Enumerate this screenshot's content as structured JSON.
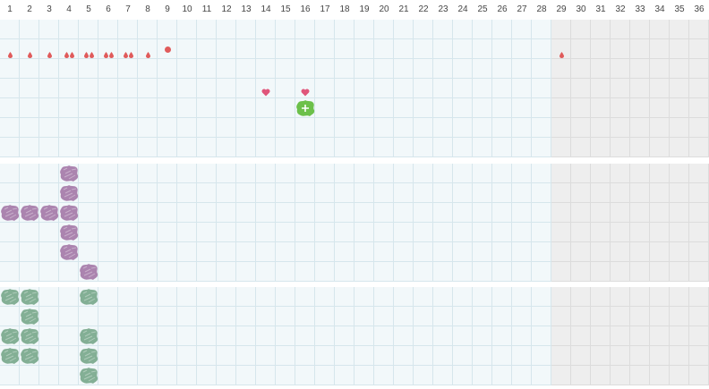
{
  "calendar": {
    "days": [
      "1",
      "2",
      "3",
      "4",
      "5",
      "6",
      "7",
      "8",
      "9",
      "10",
      "11",
      "12",
      "13",
      "14",
      "15",
      "16",
      "17",
      "18",
      "19",
      "20",
      "21",
      "22",
      "23",
      "24",
      "25",
      "26",
      "27",
      "28",
      "29",
      "30",
      "31",
      "32",
      "33",
      "34",
      "35",
      "36"
    ],
    "current_day": 28
  },
  "colors": {
    "period": "#e05b5b",
    "heart": "#e0557a",
    "ovulation": "#6cc04a",
    "symptom": "#a57aa8",
    "mood": "#7aa88c",
    "grid_line": "#d6e6ec",
    "cell_bg": "#f2f8fa",
    "future_bg": "#eeeeee"
  },
  "marks": {
    "period_flow": [
      {
        "day": 1,
        "drops": 1
      },
      {
        "day": 2,
        "drops": 1
      },
      {
        "day": 3,
        "drops": 1
      },
      {
        "day": 4,
        "drops": 2
      },
      {
        "day": 5,
        "drops": 2
      },
      {
        "day": 6,
        "drops": 2
      },
      {
        "day": 7,
        "drops": 2
      },
      {
        "day": 8,
        "drops": 1
      },
      {
        "day": 9,
        "drops": 0,
        "spotting": true
      },
      {
        "day": 29,
        "drops": 1
      }
    ],
    "hearts": [
      14,
      16
    ],
    "ovulation": [
      16
    ],
    "symptoms": [
      {
        "day": 1,
        "row": 3
      },
      {
        "day": 2,
        "row": 3
      },
      {
        "day": 3,
        "row": 3
      },
      {
        "day": 4,
        "row": 1
      },
      {
        "day": 4,
        "row": 2
      },
      {
        "day": 4,
        "row": 3
      },
      {
        "day": 4,
        "row": 4
      },
      {
        "day": 4,
        "row": 5
      },
      {
        "day": 5,
        "row": 6
      }
    ],
    "moods": [
      {
        "day": 1,
        "row": 1
      },
      {
        "day": 2,
        "row": 1
      },
      {
        "day": 5,
        "row": 1
      },
      {
        "day": 2,
        "row": 2
      },
      {
        "day": 1,
        "row": 3
      },
      {
        "day": 2,
        "row": 3
      },
      {
        "day": 5,
        "row": 3
      },
      {
        "day": 1,
        "row": 4
      },
      {
        "day": 2,
        "row": 4
      },
      {
        "day": 5,
        "row": 4
      },
      {
        "day": 5,
        "row": 5
      }
    ]
  },
  "icons": {
    "period": "drop-icon",
    "spotting": "spotting-dot-icon",
    "intercourse": "heart-icon",
    "ovulation": "ovulation-icon",
    "symptom": "symptom-blob-icon",
    "mood": "mood-blob-icon"
  }
}
